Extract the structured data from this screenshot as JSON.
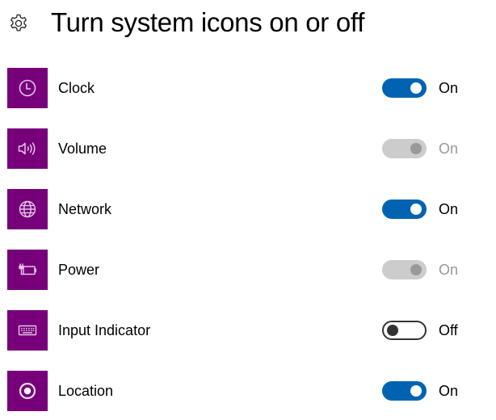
{
  "header": {
    "icon": "gear-icon",
    "title": "Turn system icons on or off"
  },
  "colors": {
    "tile": "#77007a",
    "accent": "#0063b1",
    "disabled_track": "#cccccc",
    "disabled_text": "#999999"
  },
  "items": [
    {
      "label": "Clock",
      "icon": "clock-icon",
      "state": "on",
      "enabled": true,
      "state_label": "On"
    },
    {
      "label": "Volume",
      "icon": "volume-icon",
      "state": "on",
      "enabled": false,
      "state_label": "On"
    },
    {
      "label": "Network",
      "icon": "globe-icon",
      "state": "on",
      "enabled": true,
      "state_label": "On"
    },
    {
      "label": "Power",
      "icon": "battery-plug-icon",
      "state": "on",
      "enabled": false,
      "state_label": "On"
    },
    {
      "label": "Input Indicator",
      "icon": "keyboard-icon",
      "state": "off",
      "enabled": true,
      "state_label": "Off"
    },
    {
      "label": "Location",
      "icon": "location-icon",
      "state": "on",
      "enabled": true,
      "state_label": "On"
    }
  ]
}
